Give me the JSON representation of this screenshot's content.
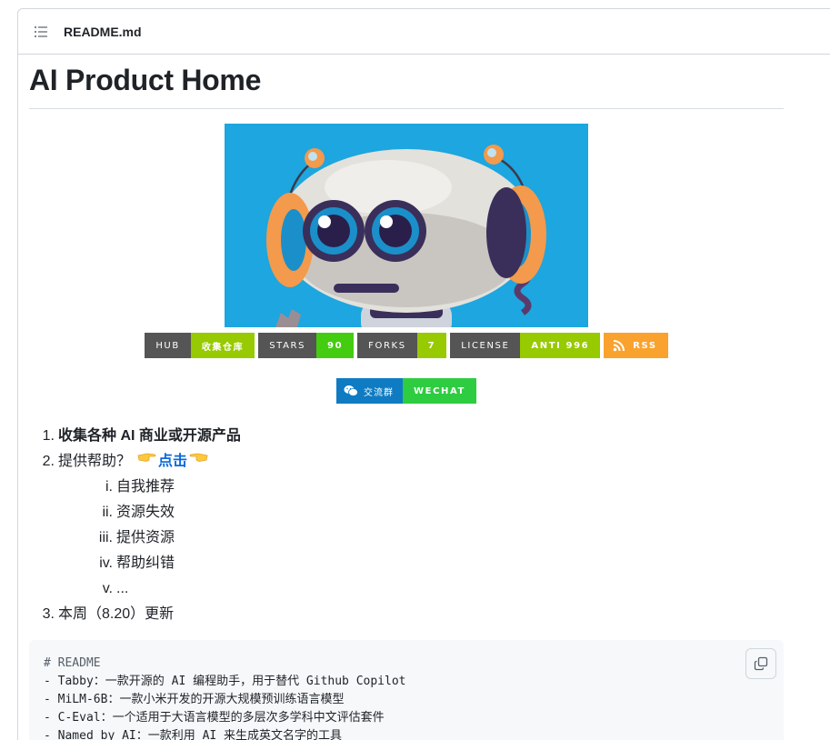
{
  "header": {
    "outline_icon": "list-unordered-icon",
    "filename": "README.md"
  },
  "title": "AI Product Home",
  "badges": [
    {
      "left": "HUB",
      "right": "收集仓库",
      "color": "#97ca00"
    },
    {
      "left": "STARS",
      "right": "90",
      "color": "#4c1"
    },
    {
      "left": "FORKS",
      "right": "7",
      "color": "#97ca00"
    },
    {
      "left": "LICENSE",
      "right": "ANTI 996",
      "color": "#97ca00"
    },
    {
      "right": "RSS",
      "color": "#f9a22e",
      "icon": "rss-icon"
    }
  ],
  "wechat_badge": {
    "left": "交流群",
    "right": "WECHAT",
    "left_color": "#0f7bc2",
    "right_color": "#2ecc40",
    "icon": "wechat-icon"
  },
  "list": {
    "item1": {
      "num": "1.",
      "text": "收集各种 AI 商业或开源产品"
    },
    "item2": {
      "num": "2.",
      "text": "提供帮助？",
      "link": "点击"
    },
    "item3": {
      "num": "3.",
      "text": "本周（8.20）更新"
    },
    "sub": [
      {
        "num": "i.",
        "text": "自我推荐"
      },
      {
        "num": "ii.",
        "text": "资源失效"
      },
      {
        "num": "iii.",
        "text": "提供资源"
      },
      {
        "num": "iv.",
        "text": "帮助纠错"
      },
      {
        "num": "v.",
        "text": "..."
      }
    ]
  },
  "code": {
    "lines": [
      "# README",
      "- Tabby：一款开源的 AI 编程助手，用于替代 Github Copilot",
      "- MiLM-6B：一款小米开发的开源大规模预训练语言模型",
      "- C-Eval：一个适用于大语言模型的多层次多学科中文评估套件",
      "- Named by AI：一款利用 AI 来生成英文名字的工具"
    ],
    "copy_icon": "copy-icon"
  }
}
